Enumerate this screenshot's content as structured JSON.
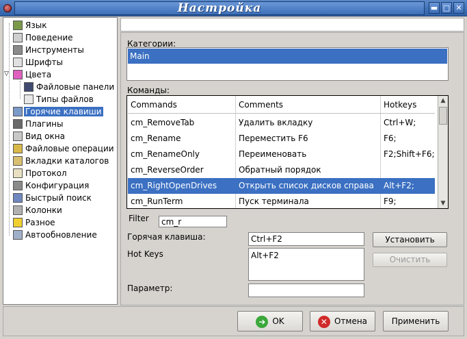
{
  "window": {
    "title": "Настройка",
    "buttons": {
      "shade": "▬",
      "maximize": "□",
      "close": "✕"
    }
  },
  "tree": {
    "items": [
      {
        "label": "Язык",
        "icon": "language-icon",
        "color": "#7a9a4a"
      },
      {
        "label": "Поведение",
        "icon": "behavior-icon",
        "color": "#cfcfcf"
      },
      {
        "label": "Инструменты",
        "icon": "tools-icon",
        "color": "#8a8a8a"
      },
      {
        "label": "Шрифты",
        "icon": "fonts-icon",
        "color": "#e0e0e0"
      },
      {
        "label": "Цвета",
        "icon": "colors-icon",
        "color": "#e060c0"
      },
      {
        "label": "Файловые панели",
        "icon": "file-panels-icon",
        "color": "#404a70"
      },
      {
        "label": "Типы файлов",
        "icon": "file-types-icon",
        "color": "#e8e8e8"
      },
      {
        "label": "Горячие клавиши",
        "icon": "hotkeys-icon",
        "color": "#7a9ac8"
      },
      {
        "label": "Плагины",
        "icon": "plugins-icon",
        "color": "#6a6a6a"
      },
      {
        "label": "Вид окна",
        "icon": "window-view-icon",
        "color": "#c8c8c8"
      },
      {
        "label": "Файловые операции",
        "icon": "file-operations-icon",
        "color": "#d8b848"
      },
      {
        "label": "Вкладки каталогов",
        "icon": "folder-tabs-icon",
        "color": "#d8c070"
      },
      {
        "label": "Протокол",
        "icon": "log-icon",
        "color": "#e8e0c0"
      },
      {
        "label": "Конфигурация",
        "icon": "configuration-icon",
        "color": "#8a8a8a"
      },
      {
        "label": "Быстрый поиск",
        "icon": "quick-search-icon",
        "color": "#7088c0"
      },
      {
        "label": "Колонки",
        "icon": "columns-icon",
        "color": "#b0b0b0"
      },
      {
        "label": "Разное",
        "icon": "misc-icon",
        "color": "#f0d030"
      },
      {
        "label": "Автообновление",
        "icon": "auto-update-icon",
        "color": "#a0b0c8"
      }
    ],
    "selected_index": 7
  },
  "categories": {
    "label": "Категории:",
    "items": [
      "Main"
    ]
  },
  "commands": {
    "label": "Команды:",
    "headers": [
      "Commands",
      "Comments",
      "Hotkeys"
    ],
    "rows": [
      [
        "cm_RemoveTab",
        "Удалить вкладку",
        "Ctrl+W;"
      ],
      [
        "cm_Rename",
        "Переместить F6",
        "F6;"
      ],
      [
        "cm_RenameOnly",
        "Переименовать",
        "F2;Shift+F6;"
      ],
      [
        "cm_ReverseOrder",
        "Обратный порядок",
        ""
      ],
      [
        "cm_RightOpenDrives",
        "Открыть список дисков справа",
        "Alt+F2;"
      ],
      [
        "cm_RunTerm",
        "Пуск терминала",
        "F9;"
      ]
    ],
    "selected_row": 4
  },
  "filter": {
    "label": "Filter",
    "value": "cm_r"
  },
  "hotkey": {
    "label": "Горячая клавиша:",
    "value": "Ctrl+F2",
    "set_button": "Установить"
  },
  "hotkeys_list": {
    "label": "Hot Keys",
    "items": [
      "Alt+F2"
    ],
    "clear_button": "Очистить"
  },
  "parameter": {
    "label": "Параметр:",
    "value": ""
  },
  "footer": {
    "ok": "OK",
    "cancel": "Отмена",
    "apply": "Применить"
  },
  "colors": {
    "selection": "#3b70c2",
    "titlebar": "#2f61a8",
    "window_bg": "#d6d3ce"
  }
}
